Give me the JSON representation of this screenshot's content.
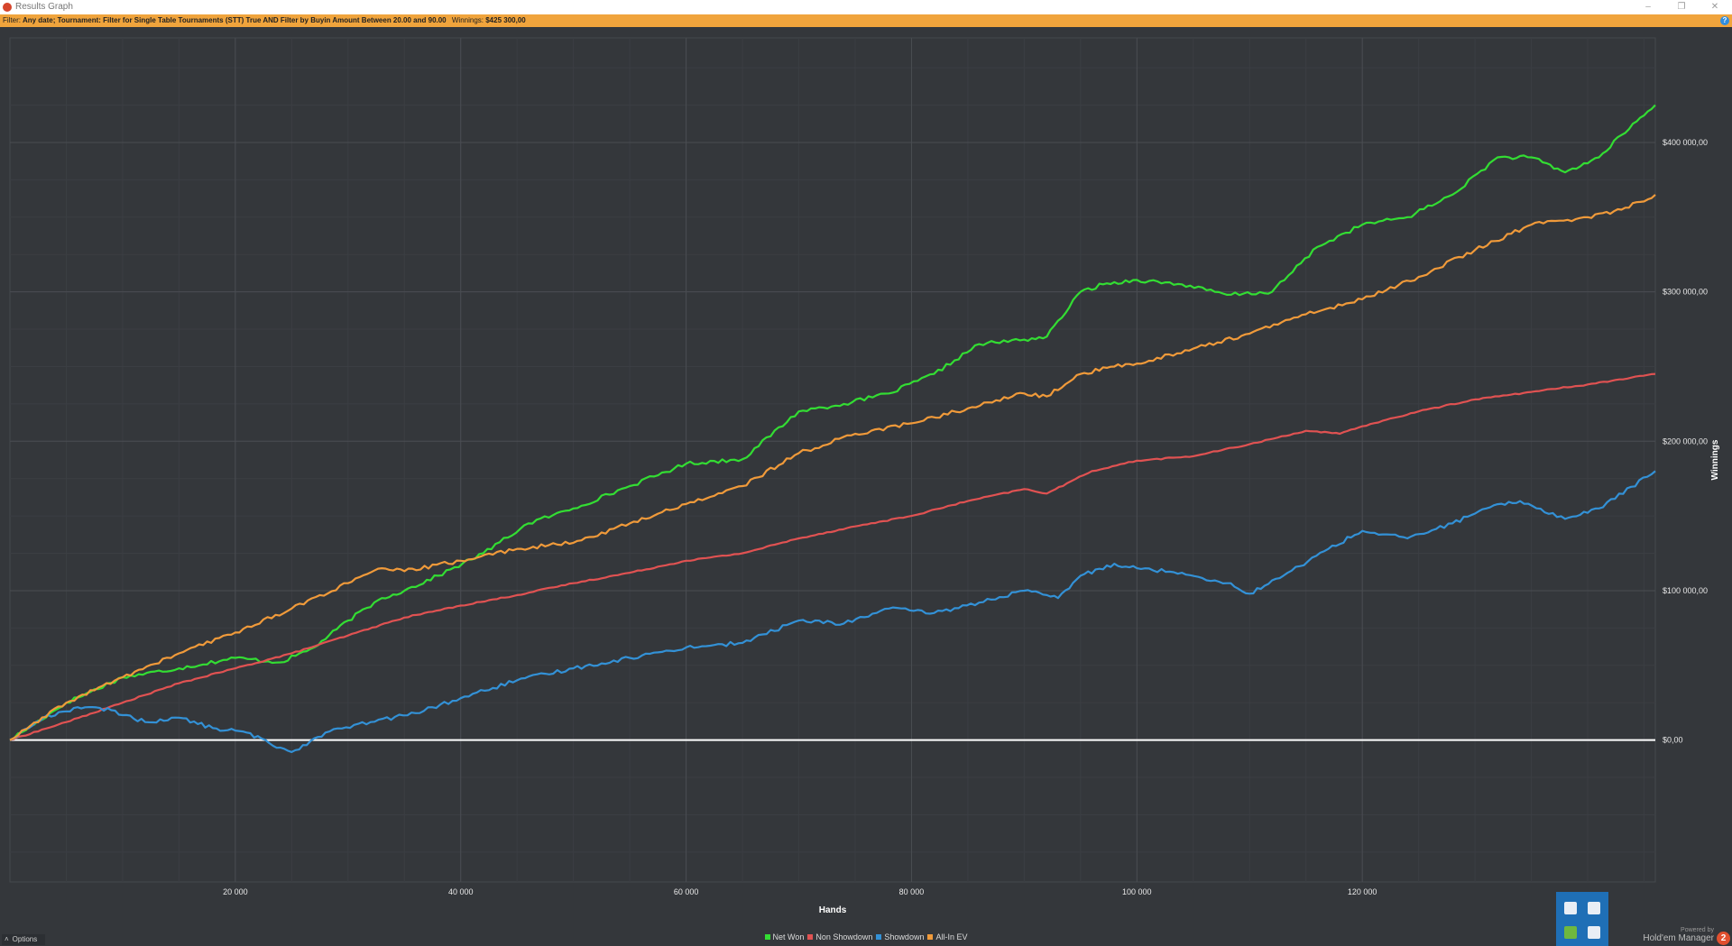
{
  "window": {
    "title": "Results Graph",
    "minimize_icon": "minimize-icon",
    "restore_icon": "restore-icon",
    "close_icon": "close-icon"
  },
  "filter_bar": {
    "label": "Filter:",
    "text": "Any date; Tournament: Filter for Single Table Tournaments (STT) True AND Filter by Buyin Amount  Between 20.00 and 90.00",
    "winnings_label": "Winnings:",
    "winnings_value": "$425 300,00",
    "help_icon": "help-icon"
  },
  "footer": {
    "options_label": "Options",
    "powered_by": "Powered by",
    "product_name": "Hold'em Manager",
    "product_version": "2"
  },
  "chart_data": {
    "type": "line",
    "title": "",
    "xlabel": "Hands",
    "ylabel": "Winnings",
    "xlim": [
      0,
      146000
    ],
    "ylim": [
      -95000,
      470000
    ],
    "x_ticks": [
      20000,
      40000,
      60000,
      80000,
      100000,
      120000
    ],
    "x_tick_labels": [
      "20 000",
      "40 000",
      "60 000",
      "80 000",
      "100 000",
      "120 000"
    ],
    "y_ticks": [
      0,
      100000,
      200000,
      300000,
      400000
    ],
    "y_tick_labels": [
      "$0,00",
      "$100 000,00",
      "$200 000,00",
      "$300 000,00",
      "$400 000,00"
    ],
    "grid": true,
    "legend_position": "bottom",
    "series": [
      {
        "name": "Net Won",
        "color": "#33dd33",
        "x": [
          0,
          5000,
          10000,
          15000,
          20000,
          24000,
          27000,
          30000,
          33000,
          35000,
          38000,
          42000,
          46000,
          50000,
          55000,
          60000,
          65000,
          70000,
          74000,
          78000,
          82000,
          86000,
          90000,
          92000,
          95000,
          97000,
          100000,
          104000,
          108000,
          112000,
          116000,
          120000,
          124000,
          128000,
          132000,
          135000,
          138000,
          141000,
          143000,
          146000
        ],
        "y": [
          0,
          25000,
          42000,
          48000,
          55000,
          52000,
          62000,
          80000,
          95000,
          100000,
          110000,
          125000,
          145000,
          155000,
          170000,
          185000,
          188000,
          220000,
          225000,
          232000,
          245000,
          265000,
          268000,
          270000,
          300000,
          305000,
          308000,
          305000,
          298000,
          300000,
          330000,
          345000,
          350000,
          365000,
          390000,
          390000,
          380000,
          390000,
          405000,
          425000
        ]
      },
      {
        "name": "Non Showdown",
        "color": "#e05252",
        "x": [
          0,
          5000,
          10000,
          15000,
          20000,
          25000,
          30000,
          35000,
          40000,
          45000,
          50000,
          55000,
          60000,
          65000,
          70000,
          75000,
          80000,
          85000,
          90000,
          92000,
          96000,
          100000,
          105000,
          110000,
          115000,
          118000,
          120000,
          125000,
          130000,
          135000,
          140000,
          146000
        ],
        "y": [
          0,
          12000,
          25000,
          38000,
          48000,
          58000,
          70000,
          82000,
          90000,
          97000,
          105000,
          112000,
          120000,
          125000,
          135000,
          143000,
          150000,
          160000,
          168000,
          165000,
          180000,
          187000,
          190000,
          198000,
          207000,
          205000,
          210000,
          220000,
          228000,
          233000,
          238000,
          245000
        ]
      },
      {
        "name": "Showdown",
        "color": "#3391d6",
        "x": [
          0,
          3000,
          6000,
          9000,
          12000,
          15000,
          18000,
          21000,
          23000,
          25000,
          28000,
          32000,
          36000,
          40000,
          45000,
          50000,
          55000,
          60000,
          65000,
          70000,
          74000,
          78000,
          82000,
          86000,
          90000,
          93000,
          95000,
          98000,
          100000,
          104000,
          108000,
          110000,
          113000,
          117000,
          120000,
          124000,
          128000,
          131000,
          134000,
          138000,
          141000,
          146000
        ],
        "y": [
          0,
          15000,
          22000,
          20000,
          12000,
          15000,
          8000,
          5000,
          -2000,
          -8000,
          5000,
          12000,
          18000,
          28000,
          40000,
          48000,
          55000,
          62000,
          65000,
          80000,
          78000,
          88000,
          85000,
          92000,
          100000,
          95000,
          110000,
          118000,
          115000,
          112000,
          105000,
          98000,
          110000,
          128000,
          140000,
          135000,
          145000,
          155000,
          160000,
          148000,
          155000,
          180000
        ]
      },
      {
        "name": "All-In EV",
        "color": "#f09a3a",
        "x": [
          0,
          5000,
          10000,
          15000,
          20000,
          25000,
          30000,
          33000,
          35000,
          40000,
          45000,
          50000,
          55000,
          60000,
          65000,
          70000,
          75000,
          80000,
          85000,
          90000,
          92000,
          95000,
          98000,
          100000,
          105000,
          110000,
          115000,
          120000,
          125000,
          130000,
          135000,
          140000,
          143000,
          146000
        ],
        "y": [
          0,
          25000,
          42000,
          58000,
          72000,
          88000,
          105000,
          115000,
          113000,
          120000,
          128000,
          132000,
          145000,
          158000,
          170000,
          192000,
          205000,
          212000,
          222000,
          232000,
          230000,
          245000,
          250000,
          252000,
          262000,
          272000,
          285000,
          295000,
          310000,
          328000,
          345000,
          350000,
          355000,
          365000
        ]
      }
    ]
  }
}
